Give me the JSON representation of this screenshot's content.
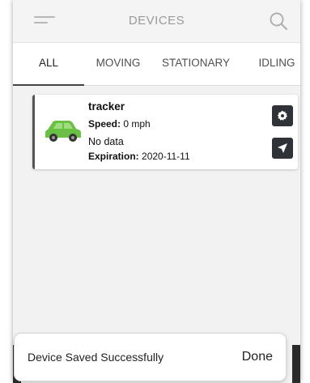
{
  "appbar": {
    "title": "DEVICES"
  },
  "tabs": [
    {
      "label": "ALL",
      "active": true
    },
    {
      "label": "MOVING",
      "active": false
    },
    {
      "label": "STATIONARY",
      "active": false
    },
    {
      "label": "IDLING",
      "active": false
    }
  ],
  "device": {
    "name": "tracker",
    "speed_label": "Speed:",
    "speed_value": "0 mph",
    "status": "No data",
    "expiration_label": "Expiration:",
    "expiration_value": "2020-11-11",
    "icon": "car-icon",
    "icon_color": "#6abf45"
  },
  "snackbar": {
    "message": "Device Saved Successfully",
    "action": "Done"
  },
  "colors": {
    "button_dark": "#2f3338",
    "accent_border": "#555555"
  }
}
